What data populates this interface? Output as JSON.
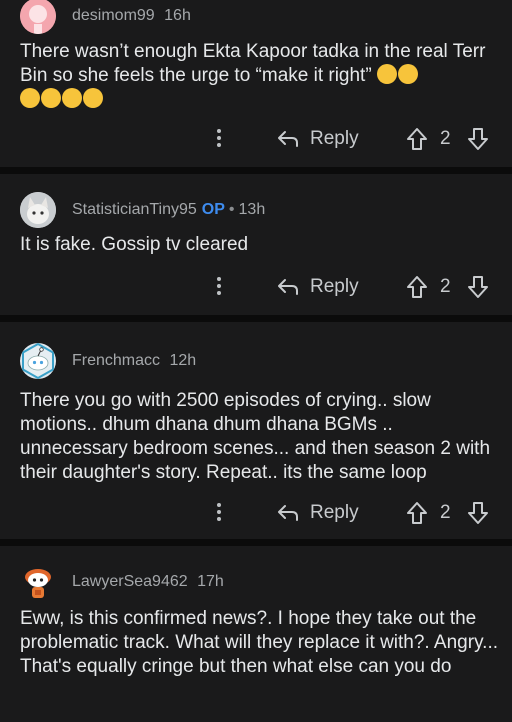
{
  "comments": [
    {
      "username": "desimom99",
      "op_badge": "",
      "time": "16h",
      "text": "There wasn’t enough Ekta Kapoor tadka in the real Terr Bin so she feels the urge to “make it right”",
      "emojis": [
        "laughing-tears",
        "laughing-tears",
        "laughing-tears",
        "yawning",
        "yawning",
        "yawning"
      ],
      "reply_label": "Reply",
      "votes": "2"
    },
    {
      "username": "StatisticianTiny95",
      "op_badge": "OP",
      "separator": "•",
      "time": "13h",
      "text": "It is fake. Gossip tv cleared",
      "reply_label": "Reply",
      "votes": "2"
    },
    {
      "username": "Frenchmacc",
      "op_badge": "",
      "time": "12h",
      "text": "There you go with 2500 episodes of crying.. slow motions.. dhum dhana dhum dhana BGMs .. unnecessary bedroom scenes... and then season 2 with their daughter's story. Repeat.. its the same loop",
      "reply_label": "Reply",
      "votes": "2"
    },
    {
      "username": "LawyerSea9462",
      "op_badge": "",
      "time": "17h",
      "text": "Eww, is this confirmed news?. I hope they take out the problematic track. What will they replace it with?. Angry... That's equally cringe but then what else can you do"
    }
  ],
  "colors": {
    "background": "#0b0b0b",
    "card": "#1a1a1b",
    "op_badge": "#3e8cef",
    "emoji": "#f7c43b"
  }
}
